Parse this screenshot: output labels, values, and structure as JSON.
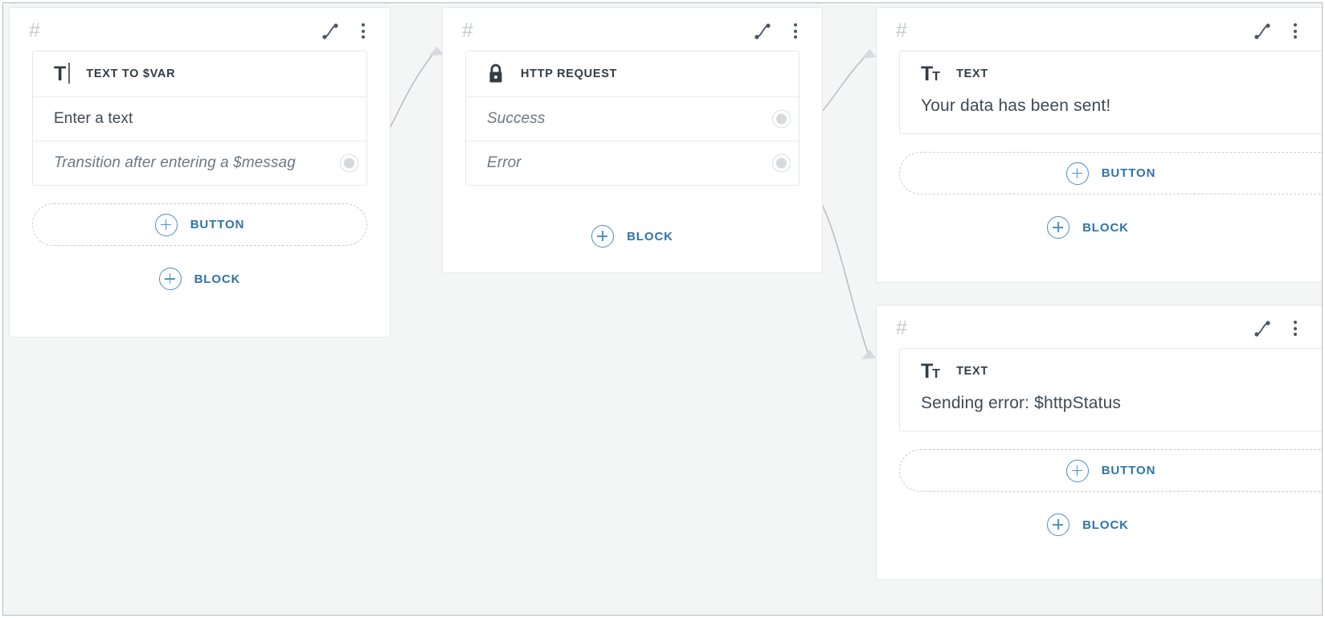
{
  "theme": {
    "canvas_bg": "#f4f6f6",
    "card_bg": "#ffffff",
    "accent_blue": "#2f74a8",
    "plus_blue": "#4a90c4",
    "text_dark": "#333c45",
    "text_muted": "#6e7881",
    "hash_gray": "#c6ccd1",
    "border": "#e6e8e8",
    "knob_gray": "#d7dadd"
  },
  "labels": {
    "hash": "#",
    "add_button": "BUTTON",
    "add_block": "BLOCK"
  },
  "cards": [
    {
      "id": "card-text-to-var",
      "hash": "#",
      "icon": "text-cursor-icon",
      "type_label": "TEXT TO $VAR",
      "value": "Enter a text",
      "transition_placeholder": "Transition after entering a $messag",
      "add_button": "BUTTON",
      "add_block": "BLOCK"
    },
    {
      "id": "card-http-request",
      "hash": "#",
      "icon": "lock-icon",
      "type_label": "HTTP REQUEST",
      "outputs": [
        {
          "label": "Success",
          "name": "success-output"
        },
        {
          "label": "Error",
          "name": "error-output"
        }
      ],
      "add_block": "BLOCK"
    },
    {
      "id": "card-text-success",
      "hash": "#",
      "icon": "text-format-icon",
      "type_label": "TEXT",
      "body": "Your data has been sent!",
      "add_button": "BUTTON",
      "add_block": "BLOCK"
    },
    {
      "id": "card-text-error",
      "hash": "#",
      "icon": "text-format-icon",
      "type_label": "TEXT",
      "body": "Sending error: $httpStatus",
      "add_button": "BUTTON",
      "add_block": "BLOCK"
    }
  ]
}
